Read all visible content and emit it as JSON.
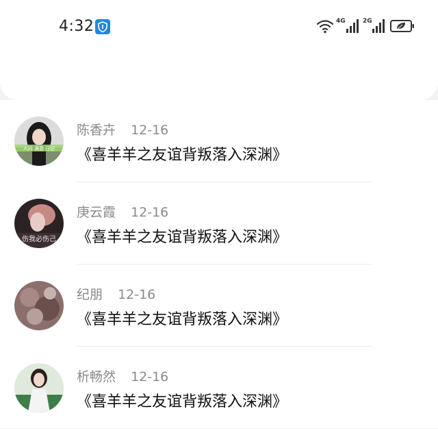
{
  "status_bar": {
    "time": "4:32",
    "net_1": "4G",
    "net_2": "2G"
  },
  "comments": [
    {
      "name": "陈香卉",
      "date": "12-16",
      "text": "《喜羊羊之友谊背叛落入深渊》",
      "avatar_caption": "人间 满意 日记"
    },
    {
      "name": "庚云霞",
      "date": "12-16",
      "text": "《喜羊羊之友谊背叛落入深渊》",
      "avatar_caption": "伤我必伤己"
    },
    {
      "name": "纪朋",
      "date": "12-16",
      "text": "《喜羊羊之友谊背叛落入深渊》",
      "avatar_caption": ""
    },
    {
      "name": "析畅然",
      "date": "12-16",
      "text": "《喜羊羊之友谊背叛落入深渊》",
      "avatar_caption": ""
    }
  ],
  "colors": {
    "shield_blue": "#1e88e5",
    "meta_gray": "#8a8a8a",
    "text_black": "#111111"
  },
  "icons": [
    "shield-icon",
    "wifi-icon",
    "signal-icon",
    "battery-icon",
    "leaf-icon"
  ]
}
